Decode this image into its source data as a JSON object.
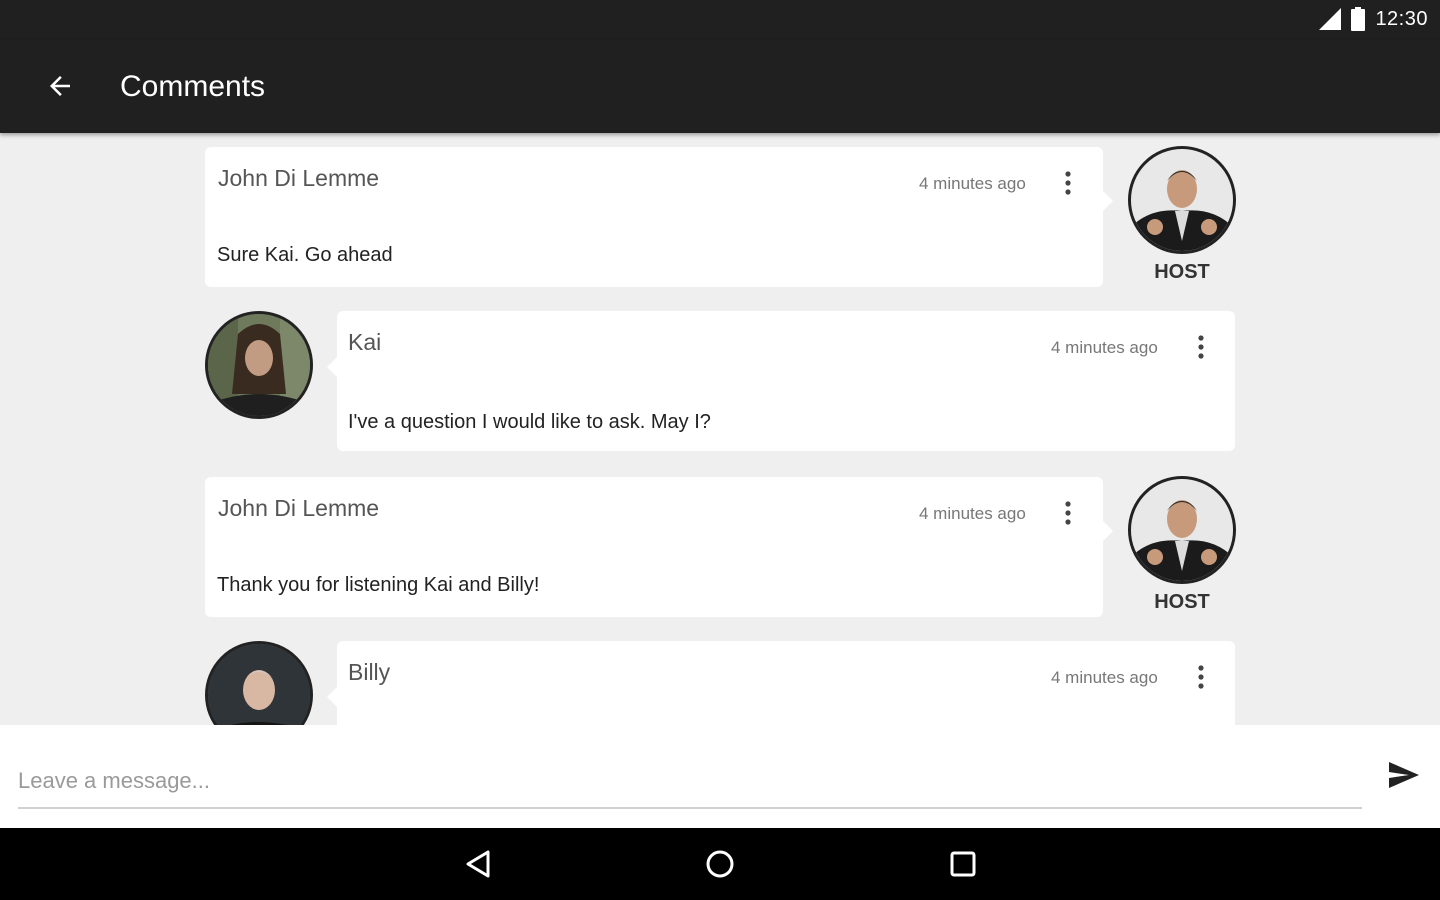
{
  "status_bar": {
    "time": "12:30"
  },
  "app_bar": {
    "title": "Comments",
    "back_icon": "arrow-left-icon"
  },
  "comments": [
    {
      "author": "John Di Lemme",
      "time": "4 minutes ago",
      "text": "Sure Kai. Go ahead",
      "side": "right",
      "role": "HOST",
      "avatar": "john-di-lemme"
    },
    {
      "author": "Kai",
      "time": "4 minutes ago",
      "text": "I've a question I would like to ask. May I?",
      "side": "left",
      "avatar": "kai"
    },
    {
      "author": "John Di Lemme",
      "time": "4 minutes ago",
      "text": "Thank you for listening Kai and Billy!",
      "side": "right",
      "role": "HOST",
      "avatar": "john-di-lemme"
    },
    {
      "author": "Billy",
      "time": "4 minutes ago",
      "text": "",
      "side": "left",
      "avatar": "billy"
    }
  ],
  "composer": {
    "placeholder": "Leave a message...",
    "value": "",
    "send_icon": "send-icon"
  },
  "nav_bar": {
    "back": "nav-back-icon",
    "home": "nav-home-icon",
    "recents": "nav-recents-icon"
  },
  "colors": {
    "bar": "#202020",
    "background": "#efefef",
    "card": "#ffffff",
    "nav": "#000000"
  }
}
